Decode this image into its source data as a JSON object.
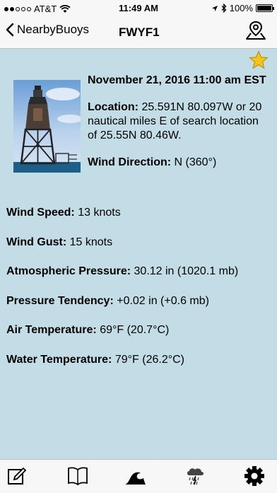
{
  "status_bar": {
    "carrier": "AT&T",
    "time": "11:49 AM",
    "battery_percent": "100%",
    "signal_bars_filled": 2,
    "battery_level": 1.0
  },
  "nav": {
    "back_label": "NearbyBuoys",
    "title": "FWYF1"
  },
  "observation": {
    "datetime": "November 21, 2016 11:00 am EST",
    "location_label": "Location:",
    "location_value": "25.591N 80.097W or 20 nautical miles E of search location of 25.55N 80.46W.",
    "wind_direction_label": "Wind Direction:",
    "wind_direction_value": "N (360°)",
    "wind_speed_label": "Wind Speed:",
    "wind_speed_value": "13 knots",
    "wind_gust_label": "Wind Gust:",
    "wind_gust_value": "15 knots",
    "pressure_label": "Atmospheric Pressure:",
    "pressure_value": "30.12 in (1020.1 mb)",
    "tendency_label": "Pressure Tendency:",
    "tendency_value": "+0.02 in (+0.6 mb)",
    "air_temp_label": "Air Temperature:",
    "air_temp_value": "69°F (20.7°C)",
    "water_temp_label": "Water Temperature:",
    "water_temp_value": "79°F (26.2°C)"
  },
  "icons": {
    "back": "chevron-left-icon",
    "map": "map-pin-icon",
    "favorite": "star-icon",
    "notes": "edit-icon",
    "book": "book-icon",
    "wave": "wave-icon",
    "weather": "storm-cloud-icon",
    "settings": "gear-icon"
  },
  "colors": {
    "content_background": "#c3dde6",
    "bar_background": "#f7f7f7",
    "star": "#f5c518"
  }
}
